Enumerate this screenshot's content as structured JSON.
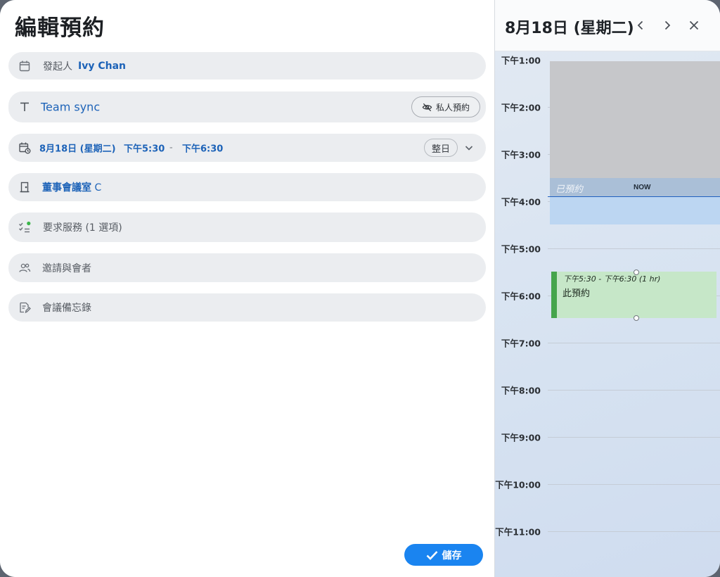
{
  "form": {
    "title": "編輯預約",
    "organizer_label": "發起人",
    "organizer_name": "Ivy Chan",
    "subject": "Team sync",
    "private_label": "私人預約",
    "date": "8月18日 (星期二)",
    "start_time": "下午5:30",
    "time_separator": "-",
    "end_time": "下午6:30",
    "all_day_label": "整日",
    "room_name": "董事會議室",
    "room_suffix": "C",
    "services_label": "要求服務 (1 選項)",
    "invite_label": "邀請與會者",
    "notes_label": "會議備忘錄",
    "save_label": "儲存"
  },
  "calendar": {
    "date_title": "8月18日 (星期二)",
    "partial_top_label": "下午1:00",
    "hours": [
      "下午2:00",
      "下午3:00",
      "下午4:00",
      "下午5:00",
      "下午6:00",
      "下午7:00",
      "下午8:00",
      "下午9:00",
      "下午10:00",
      "下午11:00"
    ],
    "booked_label": "已預約",
    "now_label": "NOW",
    "event_time": "下午5:30 - 下午6:30 (1 hr)",
    "event_title": "此預約"
  },
  "colors": {
    "accent": "#1a84f0",
    "link_blue": "#1d63b8",
    "event_green": "#45a54c",
    "event_fill": "#c6e7c8",
    "services_dot": "#3bb54a"
  },
  "icons": {
    "organizer": "calendar-icon",
    "subject": "text-icon",
    "private": "eye-off-icon",
    "datetime": "calendar-clock-icon",
    "room": "door-icon",
    "services": "checklist-icon",
    "invite": "people-icon",
    "notes": "note-edit-icon",
    "prev": "chevron-left-icon",
    "next": "chevron-right-icon",
    "close": "close-icon",
    "save": "check-icon"
  }
}
